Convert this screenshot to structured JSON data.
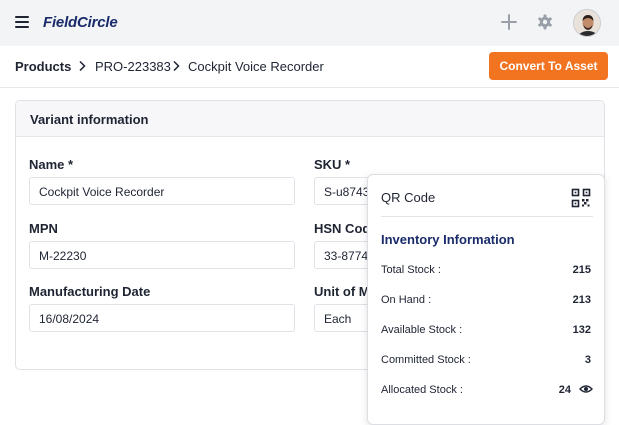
{
  "app": {
    "brand": "FieldCircle"
  },
  "breadcrumb": {
    "root": "Products",
    "parent": "PRO-223383",
    "current": "Cockpit Voice Recorder"
  },
  "actions": {
    "convert_label": "Convert To Asset",
    "accent": "#f27320"
  },
  "variant": {
    "header": "Variant information",
    "name": {
      "label": "Name *",
      "value": "Cockpit Voice Recorder"
    },
    "sku": {
      "label": "SKU *",
      "value": "S-u8743"
    },
    "mpn": {
      "label": "MPN",
      "value": "M-22230"
    },
    "hsn": {
      "label": "HSN Cod",
      "value": "33-8774"
    },
    "mfg_date": {
      "label": "Manufacturing Date",
      "value": "16/08/2024"
    },
    "unit": {
      "label": "Unit of M",
      "value": "Each"
    }
  },
  "popover": {
    "qr_title": "QR Code",
    "inventory_title": "Inventory Information",
    "rows": [
      {
        "label": "Total Stock :",
        "value": "215"
      },
      {
        "label": "On Hand :",
        "value": "213"
      },
      {
        "label": "Available Stock :",
        "value": "132"
      },
      {
        "label": "Committed Stock :",
        "value": "3"
      },
      {
        "label": "Allocated Stock :",
        "value": "24"
      }
    ]
  },
  "icons": [
    "menu-icon",
    "plus-icon",
    "gear-icon",
    "chevron-right-icon",
    "qr-code-icon",
    "eye-icon"
  ]
}
